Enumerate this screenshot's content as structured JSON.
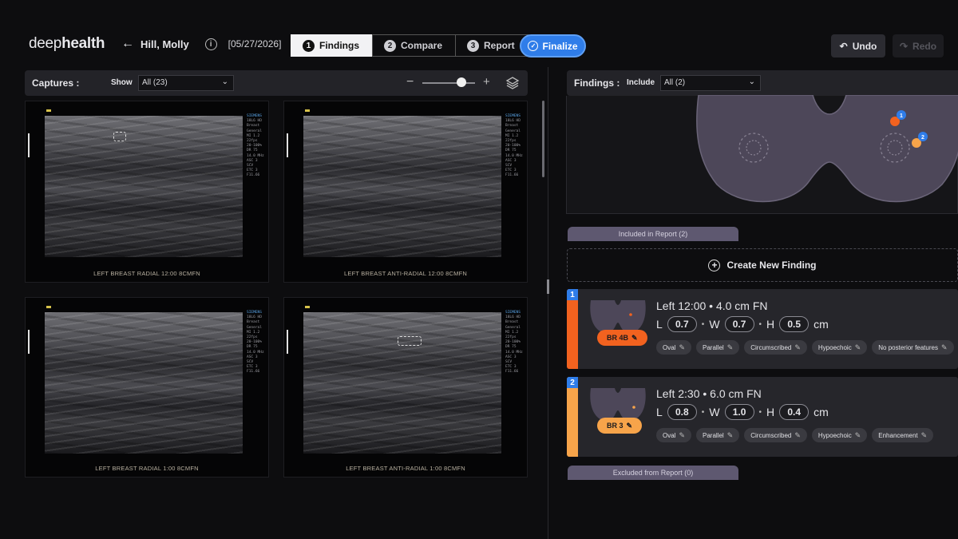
{
  "header": {
    "logo_light": "deep",
    "logo_bold": "health",
    "back_arrow": "←",
    "patient_name": "Hill, Molly",
    "info_glyph": "i",
    "date": "[05/27/2026]",
    "steps": [
      {
        "num": "1",
        "label": "Findings",
        "active": true
      },
      {
        "num": "2",
        "label": "Compare",
        "active": false
      },
      {
        "num": "3",
        "label": "Report",
        "active": false
      }
    ],
    "finalize_label": "Finalize",
    "undo_label": "Undo",
    "redo_label": "Redo",
    "accent_color": "#2f7de9"
  },
  "captures": {
    "title": "Captures :",
    "show_label": "Show",
    "show_value": "All (23)",
    "zoom_minus": "−",
    "zoom_plus": "+",
    "zoom_level": 0.7,
    "thumbnails": [
      {
        "label": "LEFT BREAST RADIAL 12:00 8CMFN",
        "roi": true
      },
      {
        "label": "LEFT BREAST ANTI-RADIAL 12:00 8CMFN",
        "roi": false
      },
      {
        "label": "LEFT BREAST RADIAL 1:00 8CMFN",
        "roi": false
      },
      {
        "label": "LEFT BREAST ANTI-RADIAL 1:00 8CMFN",
        "roi": true
      }
    ],
    "scanner_text": {
      "brand": "SIEMENS",
      "lines": "18L6 HD\nBreast\nGeneral\nMI 1.2\n22fps\n20-100%\nDR 75\n14.0 MHz\nASC 3\nSCV\nETC 3\nF11.66"
    }
  },
  "findings": {
    "title": "Findings :",
    "include_label": "Include",
    "include_value": "All (2)",
    "included_tab": "Included in Report (2)",
    "create_label": "Create New Finding",
    "excluded_tab": "Excluded from Report (0)",
    "items": [
      {
        "num": "1",
        "color": "#f2621f",
        "birads": "BR 4B",
        "location": "Left 12:00 • 4.0 cm FN",
        "L": "0.7",
        "W": "0.7",
        "H": "0.5",
        "unit": "cm",
        "tags": [
          "Oval",
          "Parallel",
          "Circumscribed",
          "Hypoechoic",
          "No posterior features"
        ]
      },
      {
        "num": "2",
        "color": "#f7a44a",
        "birads": "BR 3",
        "location": "Left 2:30 • 6.0 cm FN",
        "L": "0.8",
        "W": "1.0",
        "H": "0.4",
        "unit": "cm",
        "tags": [
          "Oval",
          "Parallel",
          "Circumscribed",
          "Hypoechoic",
          "Enhancement"
        ]
      }
    ]
  }
}
